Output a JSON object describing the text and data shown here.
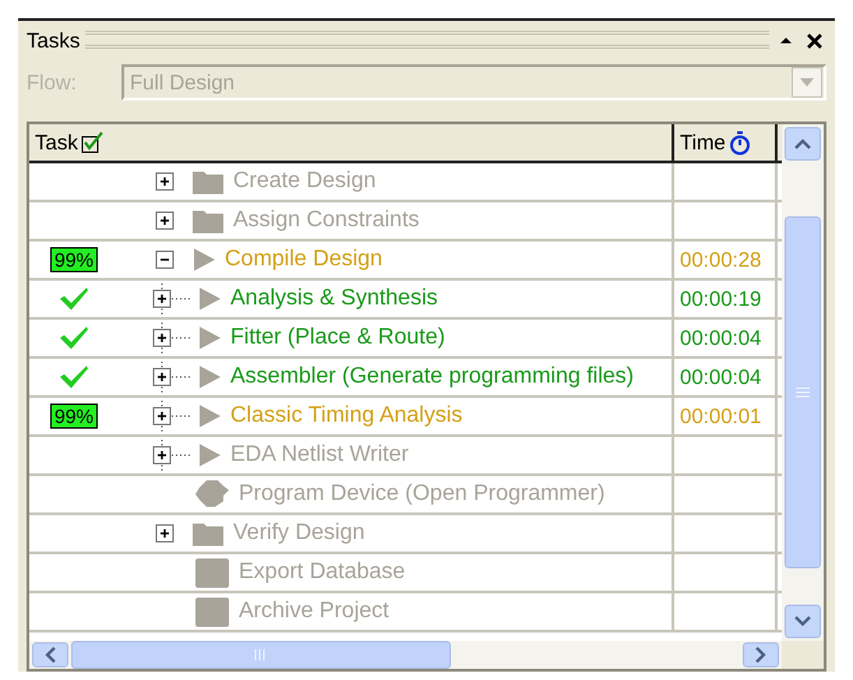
{
  "panel": {
    "title": "Tasks"
  },
  "flow": {
    "label": "Flow:",
    "value": "Full Design",
    "disabled": true
  },
  "table": {
    "columns": [
      "Task",
      "Time"
    ],
    "rows": [
      {
        "label": "Create Design",
        "kind": "folder",
        "color": "#a8a49a",
        "expanded": false
      },
      {
        "label": "Assign Constraints",
        "kind": "folder",
        "color": "#a8a49a",
        "expanded": false
      },
      {
        "label": "Compile Design",
        "kind": "step",
        "color": "#d4a017",
        "expanded": true,
        "status": {
          "kind": "progress",
          "text": "99%"
        },
        "time": "00:00:28",
        "children": [
          {
            "label": "Analysis & Synthesis",
            "kind": "step",
            "color": "#1a9a1a",
            "expanded": false,
            "status": {
              "kind": "done"
            },
            "time": "00:00:19"
          },
          {
            "label": "Fitter (Place & Route)",
            "kind": "step",
            "color": "#1a9a1a",
            "expanded": false,
            "status": {
              "kind": "done"
            },
            "time": "00:00:04"
          },
          {
            "label": "Assembler (Generate programming files)",
            "kind": "step",
            "color": "#1a9a1a",
            "expanded": false,
            "status": {
              "kind": "done"
            },
            "time": "00:00:04"
          },
          {
            "label": "Classic Timing Analysis",
            "kind": "step",
            "color": "#d4a017",
            "expanded": false,
            "status": {
              "kind": "progress",
              "text": "99%"
            },
            "time": "00:00:01"
          },
          {
            "label": "EDA Netlist Writer",
            "kind": "step",
            "color": "#a8a49a",
            "expanded": false
          }
        ]
      },
      {
        "label": "Program Device (Open Programmer)",
        "kind": "tool",
        "color": "#a8a49a"
      },
      {
        "label": "Verify Design",
        "kind": "folder",
        "color": "#a8a49a",
        "expanded": false
      },
      {
        "label": "Export Database",
        "kind": "action",
        "color": "#a8a49a"
      },
      {
        "label": "Archive Project",
        "kind": "action",
        "color": "#a8a49a"
      }
    ]
  }
}
